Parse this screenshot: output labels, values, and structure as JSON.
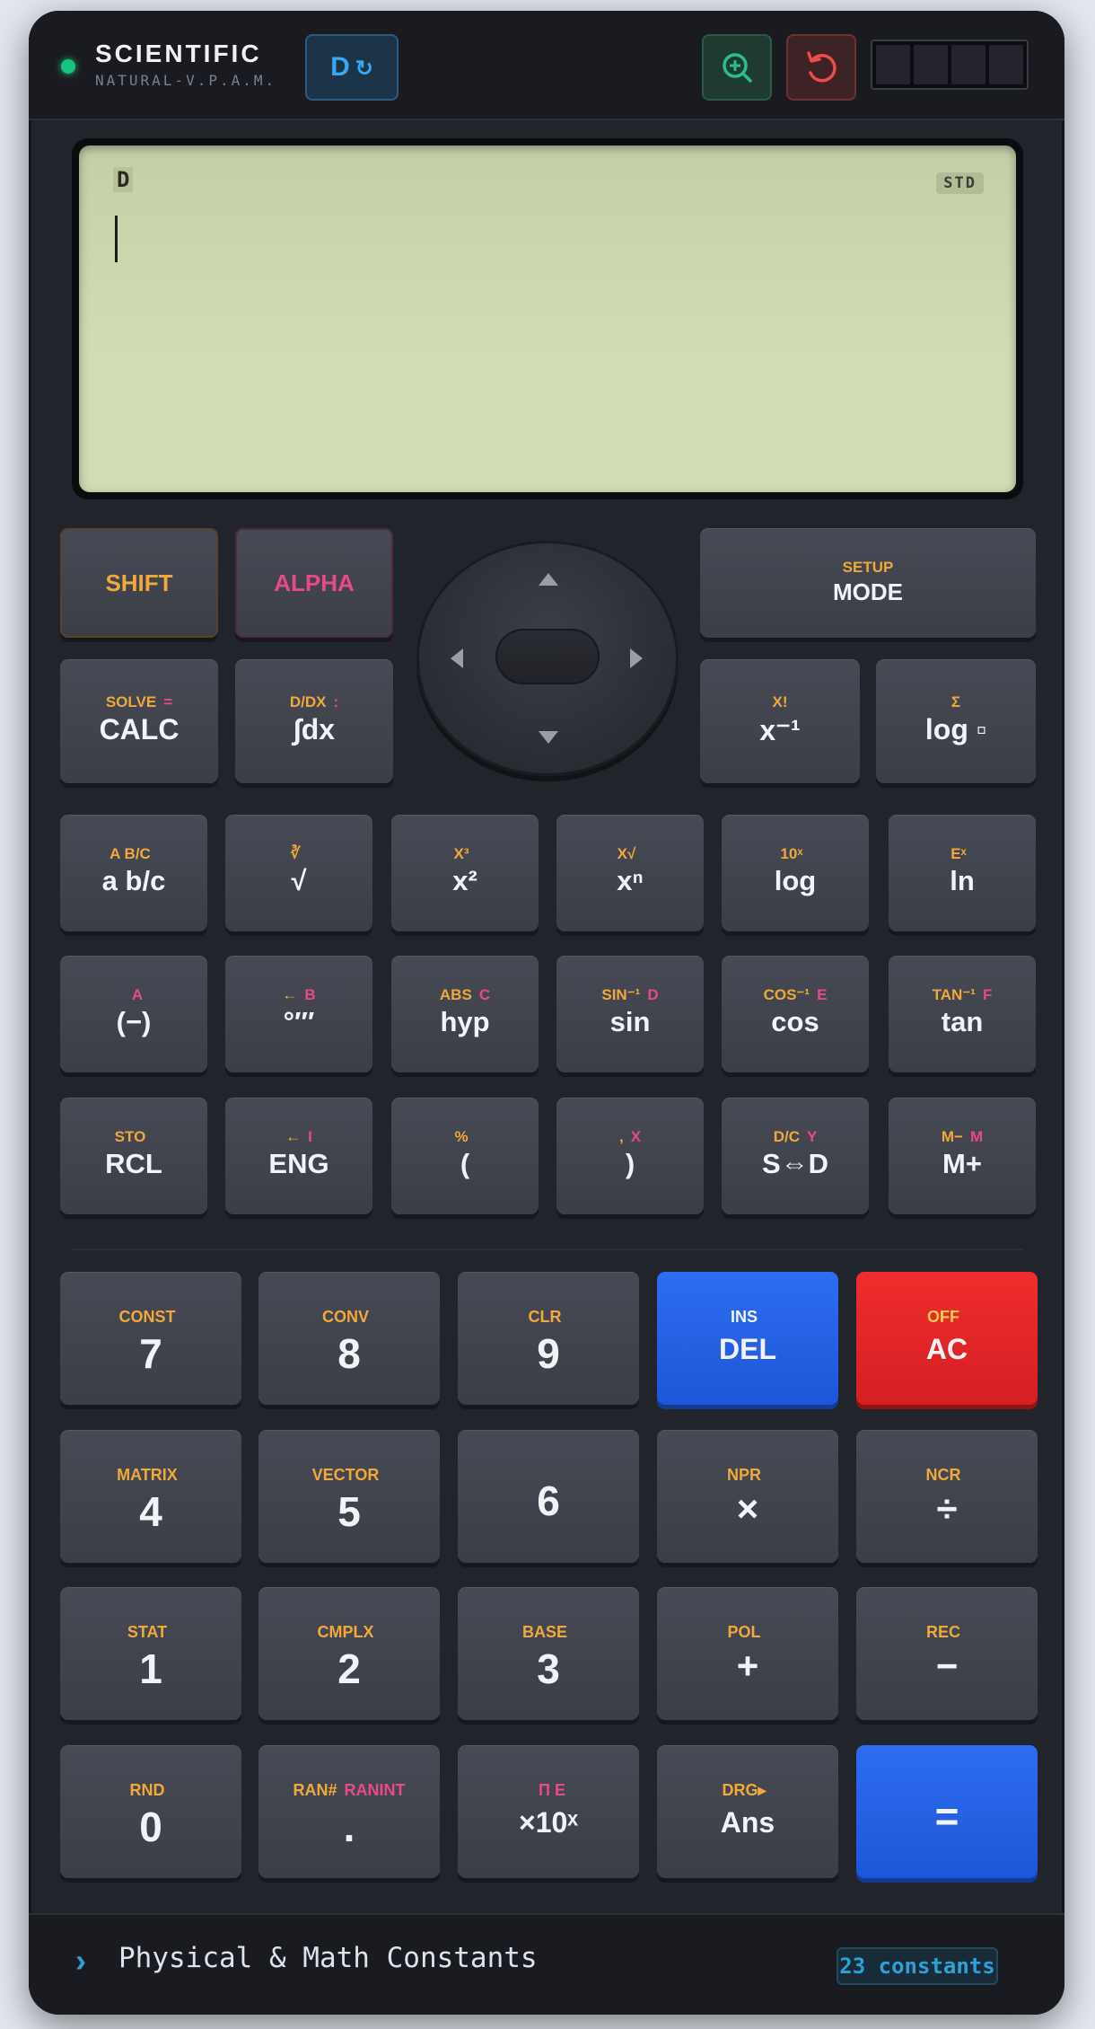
{
  "header": {
    "title": "SCIENTIFIC",
    "subtitle": "NATURAL-V.P.A.M.",
    "angle_mode": "D",
    "angle_cycle_icon": "↻",
    "zoom_icon": "zoom-in-icon",
    "reset_icon": "reset-icon"
  },
  "display": {
    "mode_indicator": "D",
    "format_indicator": "STD",
    "input": ""
  },
  "control_keys": {
    "shift": "SHIFT",
    "alpha": "ALPHA",
    "mode": {
      "sub": "SETUP",
      "main": "MODE"
    },
    "calc": {
      "sub": "SOLVE",
      "alpha": "=",
      "main": "CALC"
    },
    "integral": {
      "sub": "D/DX",
      "alpha": ":",
      "main": "∫dx"
    },
    "reciprocal": {
      "sub": "X!",
      "main": "x⁻¹"
    },
    "logbase": {
      "sub": "Σ",
      "main": "log ▫"
    }
  },
  "function_rows": [
    [
      {
        "sub": "A B/C",
        "alpha": "",
        "main": "a b/c"
      },
      {
        "sub": "∛",
        "alpha": "",
        "main": "√"
      },
      {
        "sub": "X³",
        "alpha": "",
        "main": "x²"
      },
      {
        "sub": "X√",
        "alpha": "",
        "main": "xⁿ"
      },
      {
        "sub": "10ˣ",
        "alpha": "",
        "main": "log"
      },
      {
        "sub": "Eˣ",
        "alpha": "",
        "main": "ln"
      }
    ],
    [
      {
        "sub": "",
        "alpha": "A",
        "main": "(−)"
      },
      {
        "sub": "←",
        "alpha": "B",
        "main": "°′″"
      },
      {
        "sub": "ABS",
        "alpha": "C",
        "main": "hyp"
      },
      {
        "sub": "SIN⁻¹",
        "alpha": "D",
        "main": "sin"
      },
      {
        "sub": "COS⁻¹",
        "alpha": "E",
        "main": "cos"
      },
      {
        "sub": "TAN⁻¹",
        "alpha": "F",
        "main": "tan"
      }
    ],
    [
      {
        "sub": "STO",
        "alpha": "",
        "main": "RCL"
      },
      {
        "sub": "←",
        "alpha": "I",
        "main": "ENG"
      },
      {
        "sub": "%",
        "alpha": "",
        "main": "("
      },
      {
        "sub": ",",
        "alpha": "X",
        "main": ")"
      },
      {
        "sub": "D/C",
        "alpha": "Y",
        "main": "S⇔D"
      },
      {
        "sub": "M−",
        "alpha": "M",
        "main": "M+"
      }
    ]
  ],
  "number_rows": [
    [
      {
        "sub": "CONST",
        "alpha": "",
        "main": "7"
      },
      {
        "sub": "CONV",
        "alpha": "",
        "main": "8"
      },
      {
        "sub": "CLR",
        "alpha": "",
        "main": "9"
      },
      {
        "sub": "INS",
        "alpha": "",
        "main": "DEL"
      },
      {
        "sub": "OFF",
        "alpha": "",
        "main": "AC"
      }
    ],
    [
      {
        "sub": "MATRIX",
        "alpha": "",
        "main": "4"
      },
      {
        "sub": "VECTOR",
        "alpha": "",
        "main": "5"
      },
      {
        "sub": "",
        "alpha": "",
        "main": "6"
      },
      {
        "sub": "NPR",
        "alpha": "",
        "main": "×"
      },
      {
        "sub": "NCR",
        "alpha": "",
        "main": "÷"
      }
    ],
    [
      {
        "sub": "STAT",
        "alpha": "",
        "main": "1"
      },
      {
        "sub": "CMPLX",
        "alpha": "",
        "main": "2"
      },
      {
        "sub": "BASE",
        "alpha": "",
        "main": "3"
      },
      {
        "sub": "POL",
        "alpha": "",
        "main": "+"
      },
      {
        "sub": "REC",
        "alpha": "",
        "main": "−"
      }
    ],
    [
      {
        "sub": "RND",
        "alpha": "",
        "main": "0"
      },
      {
        "sub": "RAN#",
        "alpha": "RANINT",
        "main": "."
      },
      {
        "sub": "",
        "alpha": "Π E",
        "main": "×10ˣ"
      },
      {
        "sub": "DRG▸",
        "alpha": "",
        "main": "Ans"
      },
      {
        "sub": "",
        "alpha": "",
        "main": "="
      }
    ]
  ],
  "footer": {
    "chevron": "›",
    "title": "Physical & Math Constants",
    "count": "23 constants"
  },
  "colors": {
    "shift": "#f0a93a",
    "alpha": "#e84a86",
    "accent_blue": "#1d56d8",
    "accent_red": "#d41f23",
    "lcd": "#cfdcb4"
  }
}
